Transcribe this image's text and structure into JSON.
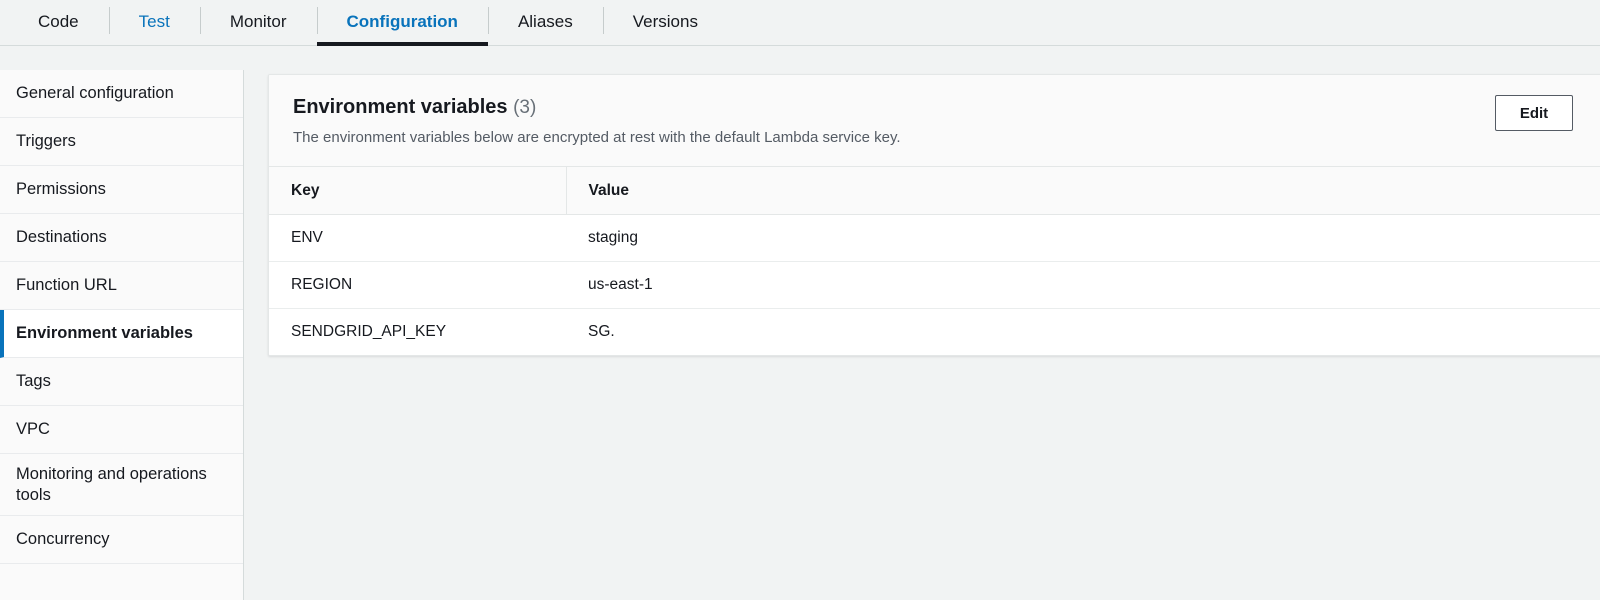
{
  "tabs": [
    {
      "label": "Code",
      "state": "default"
    },
    {
      "label": "Test",
      "state": "link"
    },
    {
      "label": "Monitor",
      "state": "default"
    },
    {
      "label": "Configuration",
      "state": "active"
    },
    {
      "label": "Aliases",
      "state": "default"
    },
    {
      "label": "Versions",
      "state": "default"
    }
  ],
  "sidebar": {
    "items": [
      {
        "label": "General configuration"
      },
      {
        "label": "Triggers"
      },
      {
        "label": "Permissions"
      },
      {
        "label": "Destinations"
      },
      {
        "label": "Function URL"
      },
      {
        "label": "Environment variables"
      },
      {
        "label": "Tags"
      },
      {
        "label": "VPC"
      },
      {
        "label": "Monitoring and operations tools"
      },
      {
        "label": "Concurrency"
      }
    ],
    "active_index": 5
  },
  "panel": {
    "title": "Environment variables",
    "count": "(3)",
    "description": "The environment variables below are encrypted at rest with the default Lambda service key.",
    "edit_label": "Edit"
  },
  "table": {
    "columns": [
      "Key",
      "Value"
    ],
    "rows": [
      {
        "key": "ENV",
        "value": "staging"
      },
      {
        "key": "REGION",
        "value": "us-east-1"
      },
      {
        "key": "SENDGRID_API_KEY",
        "value": "SG."
      }
    ]
  },
  "colors": {
    "accent": "#0973bb",
    "active_underline": "#16191f",
    "page_bg": "#f1f3f3",
    "panel_bg": "#ffffff",
    "header_bg": "#fafafa",
    "border": "#e4e7e7",
    "text": "#16191f",
    "muted_text": "#545b64"
  }
}
